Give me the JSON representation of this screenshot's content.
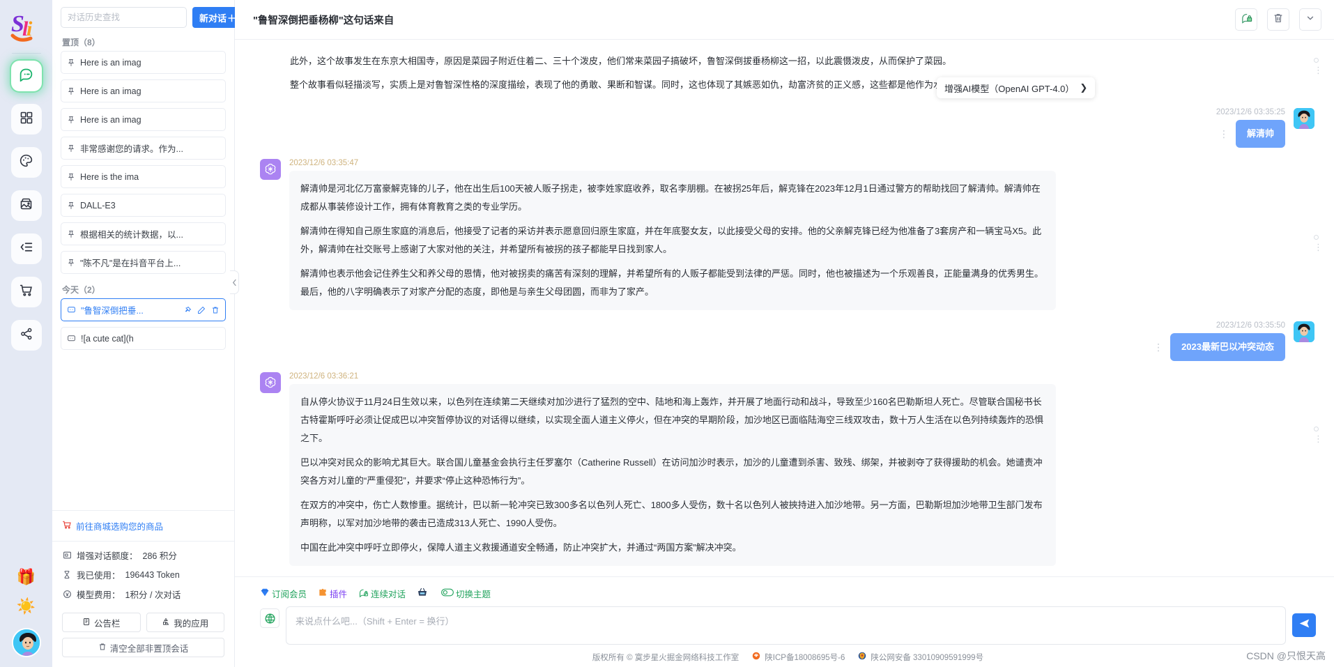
{
  "rail": {
    "logo_text": "Sii",
    "items": [
      {
        "icon": "chat-bubble-icon",
        "name": "chat",
        "active": true
      },
      {
        "icon": "grid-apps-icon",
        "name": "apps",
        "active": false
      },
      {
        "icon": "palette-icon",
        "name": "drawing",
        "active": false
      },
      {
        "icon": "image-gallery-icon",
        "name": "gallery",
        "active": false
      },
      {
        "icon": "indent-list-icon",
        "name": "prompts",
        "active": false
      },
      {
        "icon": "shopping-cart-icon",
        "name": "store",
        "active": false
      },
      {
        "icon": "share-nodes-icon",
        "name": "share",
        "active": false
      }
    ],
    "gift_emoji": "🎁",
    "sun_emoji": "☀️"
  },
  "sidebar": {
    "search_placeholder": "对话历史查找",
    "search_value": "",
    "new_chat_label": "新对话",
    "new_chat_plus": "＋",
    "pinned_group_label": "置顶（8）",
    "today_group_label": "今天（2）",
    "pinned": [
      {
        "label": "Here is an imag"
      },
      {
        "label": "Here is an imag"
      },
      {
        "label": "Here is an imag"
      },
      {
        "label": "非常感谢您的请求。作为..."
      },
      {
        "label": "Here is the ima"
      },
      {
        "label": "DALL-E3"
      },
      {
        "label": "根据相关的统计数据，以..."
      },
      {
        "label": "\"陈不凡\"是在抖音平台上..."
      }
    ],
    "today": [
      {
        "label": "\"鲁智深倒把垂...",
        "active": true,
        "actions": [
          "pin-icon",
          "edit-icon",
          "delete-icon"
        ]
      },
      {
        "label": "![a cute cat](h",
        "active": false,
        "actions": []
      }
    ],
    "shop_link": "前往商城选购您的商品",
    "stats": [
      {
        "icon": "credit-icon",
        "label": "增强对话额度：",
        "value": "286 积分"
      },
      {
        "icon": "hourglass-icon",
        "label": "我已使用：",
        "value": "196443 Token"
      },
      {
        "icon": "yen-coin-icon",
        "label": "模型费用：",
        "value": "1积分 / 次对话"
      }
    ],
    "buttons": [
      {
        "icon": "clipboard-icon",
        "label": "公告栏"
      },
      {
        "icon": "apps-small-icon",
        "label": "我的应用"
      }
    ],
    "clear_button": {
      "icon": "trash-icon",
      "label": "清空全部非置顶会话"
    }
  },
  "topbar": {
    "title": "\"鲁智深倒把垂杨柳\"这句话来自",
    "actions": [
      {
        "icon": "chat-lock-icon",
        "name": "private-chat"
      },
      {
        "icon": "trash-icon",
        "name": "delete-chat"
      },
      {
        "icon": "chevron-down-icon",
        "name": "more-options"
      }
    ]
  },
  "model_selector": {
    "label": "增强AI模型（OpenAI GPT-4.0）",
    "chevron": "❯"
  },
  "messages": [
    {
      "role": "ai-plain",
      "paragraphs": [
        "此外，这个故事发生在东京大相国寺，原因是菜园子附近住着二、三十个泼皮，他们常来菜园子搞破坏，鲁智深倒拔垂杨柳这一招，以此震慑泼皮，从而保护了菜园。",
        "整个故事看似轻描淡写，实质上是对鲁智深性格的深度描绘，表现了他的勇敢、果断和智谋。同时，这也体现了其嫉恶如仇，劫富济贫的正义感，这些都是他作为水浒英雄的重要特质。"
      ]
    },
    {
      "role": "user",
      "timestamp": "2023/12/6 03:35:25",
      "text": "解清帅"
    },
    {
      "role": "ai",
      "timestamp": "2023/12/6 03:35:47",
      "paragraphs": [
        "解清帅是河北亿万富豪解克锋的儿子，他在出生后100天被人贩子拐走，被李姓家庭收养，取名李朋棚。在被拐25年后，解克锋在2023年12月1日通过警方的帮助找回了解清帅。解清帅在成都从事装修设计工作，拥有体育教育之类的专业学历。",
        "解清帅在得知自己原生家庭的消息后，他接受了记者的采访并表示愿意回归原生家庭，并在年底娶女友，以此接受父母的安排。他的父亲解克锋已经为他准备了3套房产和一辆宝马X5。此外，解清帅在社交账号上感谢了大家对他的关注，并希望所有被拐的孩子都能早日找到家人。",
        "解清帅也表示他会记住养生父和养父母的恩情，他对被拐卖的痛苦有深刻的理解，并希望所有的人贩子都能受到法律的严惩。同时，他也被描述为一个乐观善良，正能量满身的优秀男生。最后，他的八字明确表示了对家产分配的态度，即他是与亲生父母团圆，而非为了家产。"
      ]
    },
    {
      "role": "user",
      "timestamp": "2023/12/6 03:35:50",
      "text": "2023最新巴以冲突动态"
    },
    {
      "role": "ai",
      "timestamp": "2023/12/6 03:36:21",
      "paragraphs": [
        "自从停火协议于11月24日生效以来，以色列在连续第二天继续对加沙进行了猛烈的空中、陆地和海上轰炸，并开展了地面行动和战斗，导致至少160名巴勒斯坦人死亡。尽管联合国秘书长古特霍斯呼吁必须让促成巴以冲突暂停协议的对话得以继续，以实现全面人道主义停火，但在冲突的早期阶段，加沙地区已面临陆海空三线双攻击，数十万人生活在以色列持续轰炸的恐惧之下。",
        "巴以冲突对民众的影响尤其巨大。联合国儿童基金会执行主任罗塞尔（Catherine Russell）在访问加沙时表示，加沙的儿童遭到杀害、致残、绑架，并被剥夺了获得援助的机会。她谴责冲突各方对儿童的“严重侵犯”，并要求“停止这种恐怖行为”。",
        "在双方的冲突中，伤亡人数惨重。据统计，巴以新一轮冲突已致300多名以色列人死亡、1800多人受伤，数十名以色列人被挾持进入加沙地带。另一方面，巴勒斯坦加沙地带卫生部门发布声明称，以军对加沙地带的袭击已造成313人死亡、1990人受伤。",
        "中国在此冲突中呼吁立即停火，保障人道主义救援通道安全畅通，防止冲突扩大，并通过“两国方案”解决冲突。"
      ]
    }
  ],
  "composer": {
    "tools": [
      {
        "icon": "diamond-icon",
        "label": "订阅会员",
        "color": "green"
      },
      {
        "icon": "puzzle-icon",
        "label": "插件",
        "color": "purple"
      },
      {
        "icon": "chat-lock-icon",
        "label": "连续对话",
        "color": "green"
      },
      {
        "icon": "basket-icon",
        "label": "",
        "color": "green"
      },
      {
        "icon": "toggle-icon",
        "label": "切换主题",
        "color": "green"
      }
    ],
    "placeholder": "来说点什么吧...（Shift + Enter = 换行）",
    "value": "",
    "send_icon": "send-icon",
    "plugin_icon": "plugin-globe-icon"
  },
  "footer": {
    "copyright": "版权所有 © 寞步星火掘金网络科技工作室",
    "icp": "陕ICP备18008695号-6",
    "police": "陕公网安备 33010909591999号"
  },
  "watermark": "CSDN @只恨天高"
}
